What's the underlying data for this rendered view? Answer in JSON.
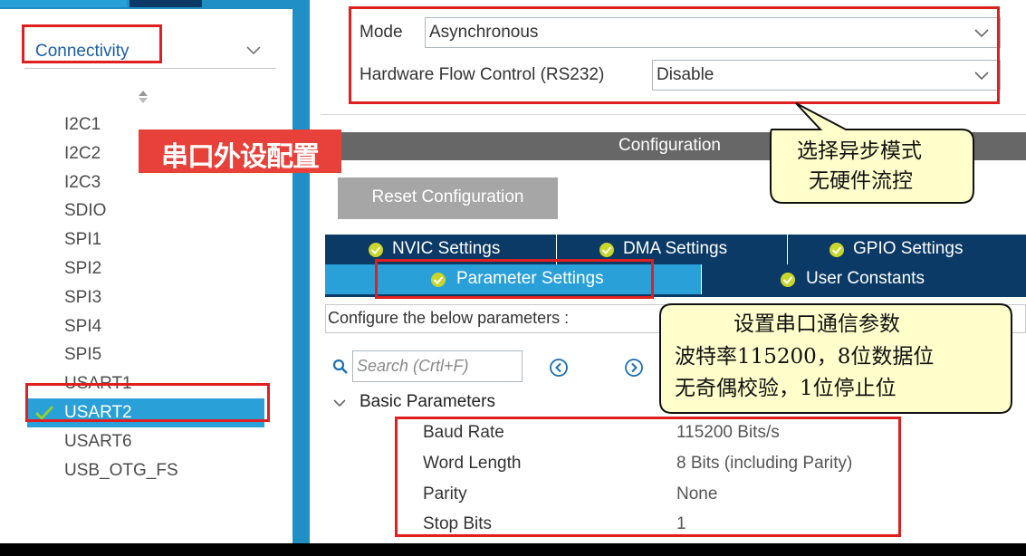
{
  "sidebar": {
    "category": "Connectivity",
    "peripherals": [
      {
        "label": "I2C1",
        "selected": false
      },
      {
        "label": "I2C2",
        "selected": false
      },
      {
        "label": "I2C3",
        "selected": false
      },
      {
        "label": "SDIO",
        "selected": false
      },
      {
        "label": "SPI1",
        "selected": false
      },
      {
        "label": "SPI2",
        "selected": false
      },
      {
        "label": "SPI3",
        "selected": false
      },
      {
        "label": "SPI4",
        "selected": false
      },
      {
        "label": "SPI5",
        "selected": false
      },
      {
        "label": "USART1",
        "selected": false
      },
      {
        "label": "USART2",
        "selected": true
      },
      {
        "label": "USART6",
        "selected": false
      },
      {
        "label": "USB_OTG_FS",
        "selected": false
      }
    ]
  },
  "mode": {
    "mode_label": "Mode",
    "mode_value": "Asynchronous",
    "flow_label": "Hardware Flow Control (RS232)",
    "flow_value": "Disable"
  },
  "configuration": {
    "title": "Configuration",
    "reset_label": "Reset Configuration",
    "tabs": [
      {
        "label": "NVIC Settings"
      },
      {
        "label": "DMA Settings"
      },
      {
        "label": "GPIO Settings"
      },
      {
        "label": "Parameter Settings",
        "active": true
      },
      {
        "label": "User Constants"
      }
    ],
    "hint": "Configure the below parameters :",
    "search_placeholder": "Search (Crtl+F)",
    "group_title": "Basic Parameters",
    "parameters": [
      {
        "name": "Baud Rate",
        "value": "115200 Bits/s"
      },
      {
        "name": "Word Length",
        "value": "8 Bits (including Parity)"
      },
      {
        "name": "Parity",
        "value": "None"
      },
      {
        "name": "Stop Bits",
        "value": "1"
      }
    ]
  },
  "annotations": {
    "peripheral_tag": "串口外设配置",
    "mode_note": [
      "选择异步模式",
      "无硬件流控"
    ],
    "param_note": [
      "设置串口通信参数",
      "波特率115200，8位数据位",
      "无奇偶校验，1位停止位"
    ]
  },
  "colors": {
    "accent_blue": "#2aa0d8",
    "navy": "#0b3a66",
    "highlight_red": "#e02020",
    "callout_fill": "#ffffcc"
  },
  "icons": [
    "chevron-down-icon",
    "sort-icon",
    "check-icon",
    "ok-circle-icon",
    "search-icon",
    "nav-prev-icon",
    "nav-next-icon",
    "expand-chevron-icon"
  ]
}
